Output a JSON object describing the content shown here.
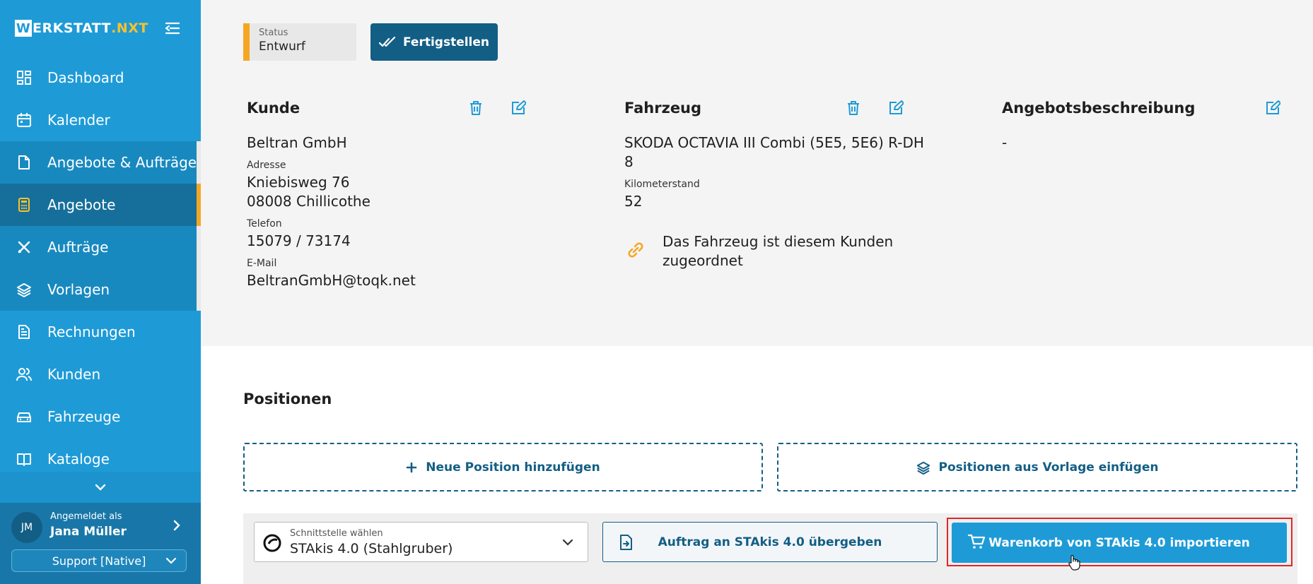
{
  "brand": {
    "prefix": "W",
    "name": "ERKSTATT",
    "suffix": ".NXT"
  },
  "sidebar": {
    "items": [
      {
        "label": "Dashboard",
        "icon": "dashboard-icon"
      },
      {
        "label": "Kalender",
        "icon": "calendar-icon"
      },
      {
        "label": "Angebote & Aufträge",
        "icon": "document-icon"
      },
      {
        "label": "Angebote",
        "icon": "calculator-icon"
      },
      {
        "label": "Aufträge",
        "icon": "tools-icon"
      },
      {
        "label": "Vorlagen",
        "icon": "layers-icon"
      },
      {
        "label": "Rechnungen",
        "icon": "invoice-icon"
      },
      {
        "label": "Kunden",
        "icon": "users-icon"
      },
      {
        "label": "Fahrzeuge",
        "icon": "car-icon"
      },
      {
        "label": "Kataloge",
        "icon": "book-icon"
      }
    ],
    "user": {
      "initials": "JM",
      "label": "Angemeldet als",
      "name": "Jana Müller"
    },
    "support": "Support [Native]"
  },
  "header": {
    "status_label": "Status",
    "status_value": "Entwurf",
    "finish_label": "Fertigstellen"
  },
  "customer": {
    "title": "Kunde",
    "name": "Beltran GmbH",
    "address_label": "Adresse",
    "street": "Kniebisweg 76",
    "city": "08008 Chillicothe",
    "phone_label": "Telefon",
    "phone": "15079 / 73174",
    "email_label": "E-Mail",
    "email": "BeltranGmbH@toqk.net"
  },
  "vehicle": {
    "title": "Fahrzeug",
    "name_line1": "SKODA OCTAVIA III Combi (5E5, 5E6) R-DH",
    "name_line2": "8",
    "km_label": "Kilometerstand",
    "km": "52",
    "linked_line1": "Das Fahrzeug ist diesem Kunden",
    "linked_line2": "zugeordnet"
  },
  "offer": {
    "title": "Angebotsbeschreibung",
    "description": "-"
  },
  "positions": {
    "title": "Positionen",
    "add_label": "Neue Position hinzufügen",
    "template_label": "Positionen aus Vorlage einfügen"
  },
  "interface": {
    "select_label": "Schnittstelle wählen",
    "select_value": "STAkis 4.0 (Stahlgruber)",
    "transfer_label": "Auftrag an STAkis 4.0 übergeben",
    "import_label": "Warenkorb von STAkis 4.0 importieren"
  },
  "colors": {
    "sidebar": "#1e9bd7",
    "primary_dark": "#135e85",
    "accent": "#f5a623",
    "highlight": "#e0262b"
  }
}
